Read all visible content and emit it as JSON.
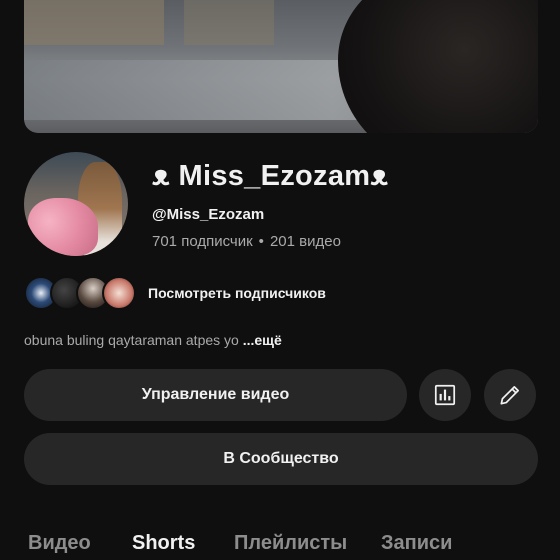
{
  "channel": {
    "name": "ᴥ Miss_Ezozamᴥ",
    "handle": "@Miss_Ezozam",
    "subscribers": "701 подписчик",
    "separator": "•",
    "videos": "201 видео"
  },
  "subscribers_preview": {
    "link_label": "Посмотреть подписчиков"
  },
  "description": {
    "text": "obuna buling qaytaraman atpes yo ",
    "more": "...ещё"
  },
  "actions": {
    "manage_label": "Управление видео",
    "stats_icon": "bar-chart-icon",
    "edit_icon": "pencil-icon",
    "community_label": "В Сообщество"
  },
  "tabs": [
    {
      "label": "Видео",
      "active": false
    },
    {
      "label": "Shorts",
      "active": true
    },
    {
      "label": "Плейлисты",
      "active": false
    },
    {
      "label": "Записи",
      "active": false
    }
  ],
  "colors": {
    "background": "#0f0f0f",
    "button": "#272727",
    "text_primary": "#f1f1f1",
    "text_secondary": "#aaaaaa"
  }
}
